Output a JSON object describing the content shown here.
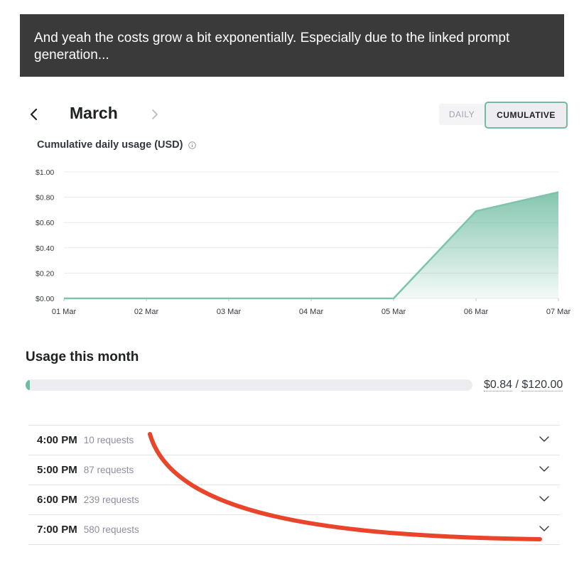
{
  "banner": {
    "text": "And yeah the costs grow a bit exponentially. Especially due to the linked prompt generation..."
  },
  "header": {
    "month": "March",
    "prev_icon": "chevron-left-icon",
    "next_icon": "chevron-right-icon",
    "toggle": {
      "daily_label": "DAILY",
      "cumulative_label": "CUMULATIVE",
      "selected": "cumulative"
    }
  },
  "chart_data": {
    "type": "area",
    "title": "Cumulative daily usage (USD)",
    "x": [
      "01 Mar",
      "02 Mar",
      "03 Mar",
      "04 Mar",
      "05 Mar",
      "06 Mar",
      "07 Mar"
    ],
    "y_tick_labels": [
      "$0.00",
      "$0.20",
      "$0.40",
      "$0.60",
      "$0.80",
      "$1.00"
    ],
    "y_ticks": [
      0,
      0.2,
      0.4,
      0.6,
      0.8,
      1.0
    ],
    "series": [
      {
        "values": [
          0,
          0,
          0,
          0,
          0,
          0.69,
          0.84
        ]
      }
    ],
    "ylim": [
      0,
      1.0
    ],
    "grid": true,
    "colors": {
      "line": "#7cc5aa",
      "fill": "#6fbca1",
      "grid": "#e8e8ec"
    }
  },
  "usage": {
    "heading": "Usage this month",
    "used": "$0.84",
    "separator": "/",
    "limit": "$120.00",
    "fraction": 0.007
  },
  "hourly": [
    {
      "time": "4:00 PM",
      "requests": "10 requests"
    },
    {
      "time": "5:00 PM",
      "requests": "87 requests"
    },
    {
      "time": "6:00 PM",
      "requests": "239 requests"
    },
    {
      "time": "7:00 PM",
      "requests": "580 requests"
    }
  ],
  "annotation": {
    "color": "#e8452a"
  }
}
